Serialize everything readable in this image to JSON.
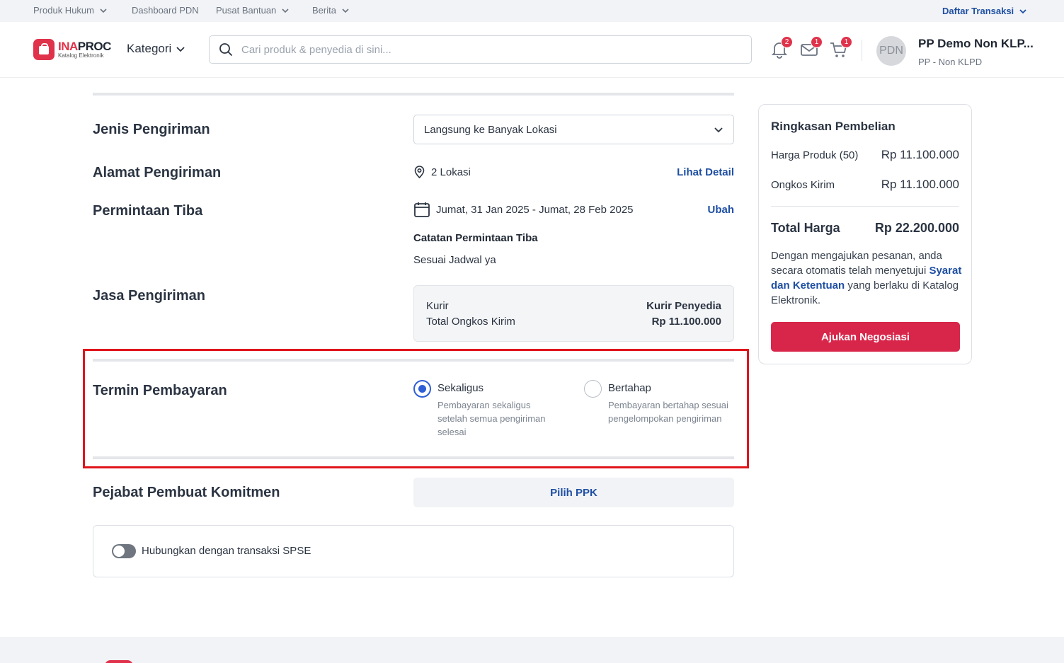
{
  "topnav": {
    "items": [
      "Produk Hukum",
      "Dashboard PDN",
      "Pusat Bantuan",
      "Berita"
    ],
    "right": "Daftar Transaksi"
  },
  "header": {
    "logo_main_a": "INA",
    "logo_main_b": "PROC",
    "logo_sub": "Katalog Elektronik",
    "kategori": "Kategori",
    "search_placeholder": "Cari produk & penyedia di sini...",
    "badges": {
      "notifications": "2",
      "messages": "1",
      "cart": "1"
    },
    "avatar_initials": "PDN",
    "user_name": "PP Demo Non KLP...",
    "user_role": "PP - Non KLPD"
  },
  "form": {
    "jenis_label": "Jenis Pengiriman",
    "jenis_value": "Langsung ke Banyak Lokasi",
    "alamat_label": "Alamat Pengiriman",
    "alamat_value": "2 Lokasi",
    "alamat_link": "Lihat Detail",
    "tiba_label": "Permintaan Tiba",
    "tiba_value": "Jumat, 31 Jan 2025 - Jumat, 28 Feb 2025",
    "tiba_link": "Ubah",
    "catatan_title": "Catatan Permintaan Tiba",
    "catatan_value": "Sesuai Jadwal ya",
    "jasa_label": "Jasa Pengiriman",
    "kurir_label": "Kurir",
    "kurir_value": "Kurir Penyedia",
    "ongkir_label": "Total Ongkos Kirim",
    "ongkir_value": "Rp 11.100.000",
    "termin_label": "Termin Pembayaran",
    "termin_options": [
      {
        "title": "Sekaligus",
        "desc1": "Pembayaran sekaligus",
        "desc2": "setelah semua pengiriman",
        "desc3": "selesai",
        "selected": true
      },
      {
        "title": "Bertahap",
        "desc1": "Pembayaran bertahap sesuai",
        "desc2": "pengelompokan pengiriman",
        "selected": false
      }
    ],
    "ppk_label": "Pejabat Pembuat Komitmen",
    "ppk_button": "Pilih PPK",
    "spse_label": "Hubungkan dengan transaksi SPSE",
    "spse_on": false
  },
  "summary": {
    "title": "Ringkasan Pembelian",
    "harga_label": "Harga Produk (50)",
    "harga_value": "Rp 11.100.000",
    "ongkir_label": "Ongkos Kirim",
    "ongkir_value": "Rp 11.100.000",
    "total_label": "Total Harga",
    "total_value": "Rp 22.200.000",
    "terms_pre": "Dengan mengajukan pesanan, anda secara otomatis telah menyetujui",
    "terms_link": "Syarat dan Ketentuan",
    "terms_post": "yang berlaku di Katalog Elektronik.",
    "cta": "Ajukan Negosiasi"
  },
  "colors": {
    "accent_blue": "#1e4fa3",
    "brand_red": "#d8264a",
    "highlight_red": "#e0141c",
    "radio_blue": "#2f5fd6"
  }
}
